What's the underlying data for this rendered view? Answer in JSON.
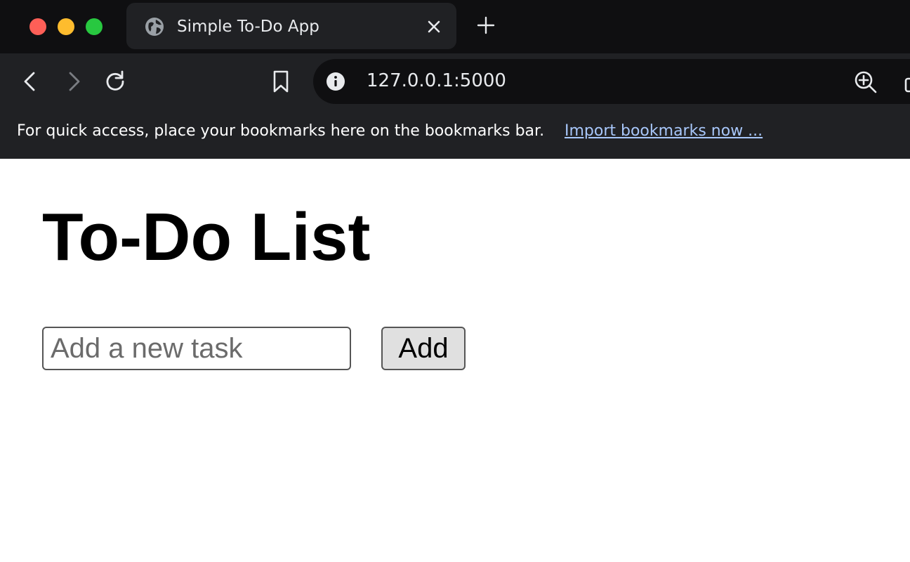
{
  "browser": {
    "tab": {
      "title": "Simple To-Do App",
      "favicon": "globe-icon"
    },
    "address_bar": {
      "url": "127.0.0.1:5000"
    },
    "bookmarks_bar": {
      "message": "For quick access, place your bookmarks here on the bookmarks bar.",
      "link_label": "Import bookmarks now ..."
    }
  },
  "page": {
    "heading": "To-Do List",
    "task_input": {
      "value": "",
      "placeholder": "Add a new task"
    },
    "add_button_label": "Add"
  }
}
